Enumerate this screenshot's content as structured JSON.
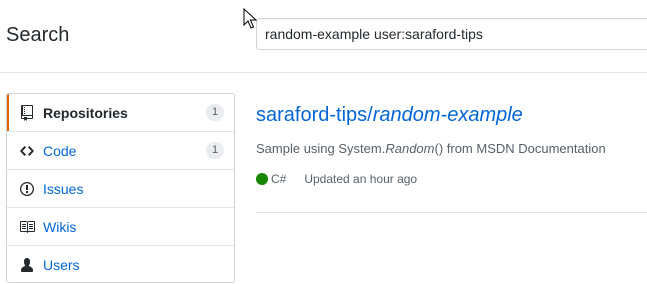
{
  "header": {
    "title": "Search"
  },
  "search": {
    "query": "random-example user:saraford-tips"
  },
  "menu": {
    "items": [
      {
        "label": "Repositories",
        "count": "1",
        "icon": "repo-icon"
      },
      {
        "label": "Code",
        "count": "1",
        "icon": "code-icon"
      },
      {
        "label": "Issues",
        "icon": "issue-icon"
      },
      {
        "label": "Wikis",
        "icon": "book-icon"
      },
      {
        "label": "Users",
        "icon": "person-icon"
      }
    ]
  },
  "result": {
    "owner": "saraford-tips/",
    "name": "random-example",
    "description_prefix": "Sample using System.",
    "description_italic": "Random",
    "description_suffix": "() from MSDN Documentation",
    "language": "C#",
    "language_color": "#178600",
    "updated": "Updated an hour ago"
  },
  "colors": {
    "link": "#0366d6",
    "selected_accent": "#e36209"
  }
}
